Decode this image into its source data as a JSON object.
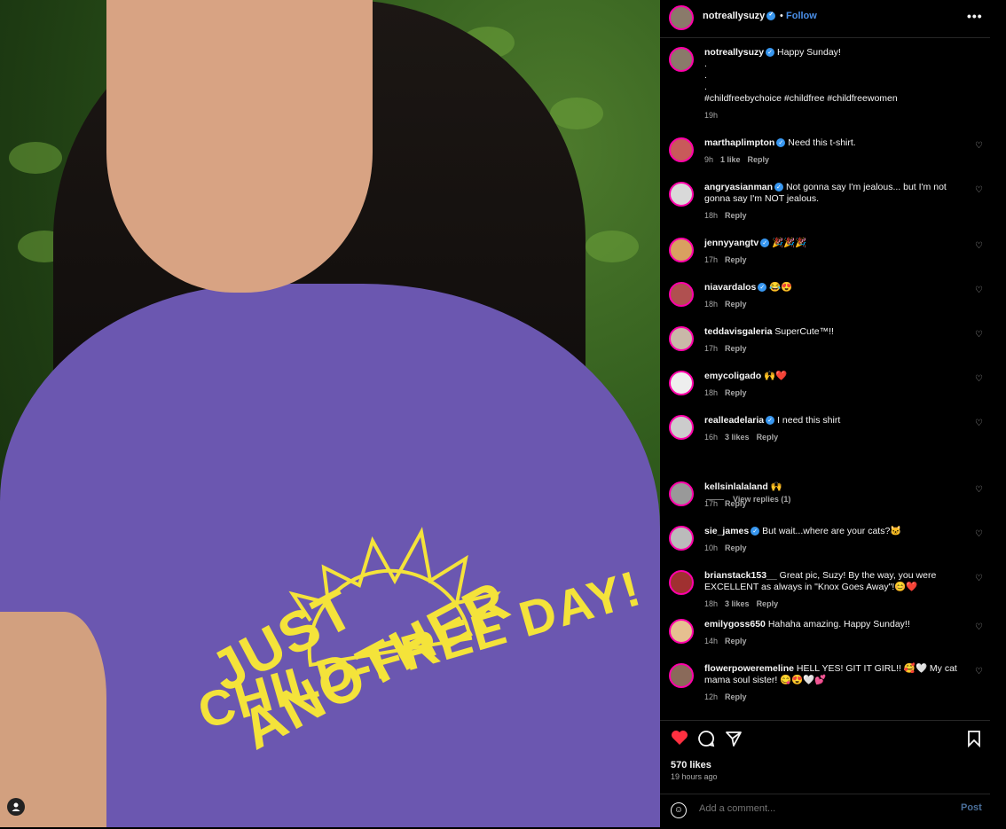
{
  "post": {
    "username": "notreallysuzy",
    "follow_label": "Follow",
    "dot": "•",
    "more_icon": "more-horizontal-icon",
    "caption_lines": [
      "Happy Sunday!",
      ".",
      ".",
      ".",
      "#childfreebychoice #childfree #childfreewomen"
    ],
    "caption_time": "19h"
  },
  "photo": {
    "shirt_text_line1": "JUST ANOTHER",
    "shirt_text_line2": "CHILD-FREE DAY!"
  },
  "comments": [
    {
      "user": "marthaplimpton",
      "verified": true,
      "text": "Need this t-shirt.",
      "time": "9h",
      "likes": "1 like",
      "reply": "Reply"
    },
    {
      "user": "angryasianman",
      "verified": true,
      "text": "Not gonna say I'm jealous... but I'm not gonna say I'm NOT jealous.",
      "time": "18h",
      "likes": "",
      "reply": "Reply"
    },
    {
      "user": "jennyyangtv",
      "verified": true,
      "text": "🎉🎉🎉",
      "time": "17h",
      "likes": "",
      "reply": "Reply"
    },
    {
      "user": "niavardalos",
      "verified": true,
      "text": "😂😍",
      "time": "18h",
      "likes": "",
      "reply": "Reply"
    },
    {
      "user": "teddavisgaleria",
      "verified": false,
      "text": "SuperCute™!!",
      "time": "17h",
      "likes": "",
      "reply": "Reply"
    },
    {
      "user": "emycoligado",
      "verified": false,
      "text": "🙌❤️",
      "time": "18h",
      "likes": "",
      "reply": "Reply"
    },
    {
      "user": "realleadelaria",
      "verified": true,
      "text": "I need this shirt",
      "time": "16h",
      "likes": "3 likes",
      "reply": "Reply"
    },
    {
      "user": "kellsinlalaland",
      "verified": false,
      "text": "🙌",
      "time": "17h",
      "likes": "",
      "reply": "Reply"
    },
    {
      "user": "sie_james",
      "verified": true,
      "text": "But wait...where are your cats?🐱",
      "time": "10h",
      "likes": "",
      "reply": "Reply"
    },
    {
      "user": "brianstack153__",
      "verified": false,
      "text": "Great pic, Suzy! By the way, you were EXCELLENT as always in \"Knox Goes Away\"!😊❤️",
      "time": "18h",
      "likes": "3 likes",
      "reply": "Reply"
    },
    {
      "user": "emilygoss650",
      "verified": false,
      "text": "Hahaha amazing. Happy Sunday!!",
      "time": "14h",
      "likes": "",
      "reply": "Reply"
    },
    {
      "user": "flowerpoweremeline",
      "verified": false,
      "text": "HELL YES! GIT IT GIRL!! 🥰🤍 My cat mama soul sister! 😋😍🤍💕",
      "time": "12h",
      "likes": "",
      "reply": "Reply"
    }
  ],
  "view_replies": "View replies (1)",
  "actions": {
    "likes": "570 likes",
    "time_ago": "19 hours ago",
    "comment_placeholder": "Add a comment...",
    "post_label": "Post",
    "liked_color": "#ff3040"
  }
}
